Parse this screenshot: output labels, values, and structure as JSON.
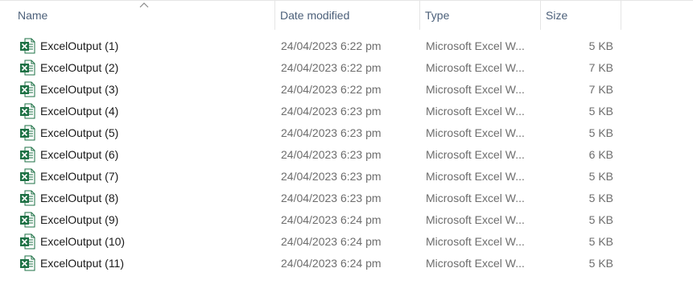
{
  "columns": {
    "name": "Name",
    "date_modified": "Date modified",
    "type": "Type",
    "size": "Size"
  },
  "sort": {
    "column": "name",
    "direction": "ascending",
    "icon": "chevron-up-icon"
  },
  "file_icon": "excel-file-icon",
  "colors": {
    "header_text": "#4c607a",
    "excel_green": "#1e7145",
    "muted_text": "#6d6d6d"
  },
  "files": [
    {
      "name": "ExcelOutput (1)",
      "date": "24/04/2023 6:22 pm",
      "type": "Microsoft Excel W...",
      "size": "5 KB"
    },
    {
      "name": "ExcelOutput (2)",
      "date": "24/04/2023 6:22 pm",
      "type": "Microsoft Excel W...",
      "size": "7 KB"
    },
    {
      "name": "ExcelOutput (3)",
      "date": "24/04/2023 6:22 pm",
      "type": "Microsoft Excel W...",
      "size": "7 KB"
    },
    {
      "name": "ExcelOutput (4)",
      "date": "24/04/2023 6:23 pm",
      "type": "Microsoft Excel W...",
      "size": "5 KB"
    },
    {
      "name": "ExcelOutput (5)",
      "date": "24/04/2023 6:23 pm",
      "type": "Microsoft Excel W...",
      "size": "5 KB"
    },
    {
      "name": "ExcelOutput (6)",
      "date": "24/04/2023 6:23 pm",
      "type": "Microsoft Excel W...",
      "size": "6 KB"
    },
    {
      "name": "ExcelOutput (7)",
      "date": "24/04/2023 6:23 pm",
      "type": "Microsoft Excel W...",
      "size": "5 KB"
    },
    {
      "name": "ExcelOutput (8)",
      "date": "24/04/2023 6:23 pm",
      "type": "Microsoft Excel W...",
      "size": "5 KB"
    },
    {
      "name": "ExcelOutput (9)",
      "date": "24/04/2023 6:24 pm",
      "type": "Microsoft Excel W...",
      "size": "5 KB"
    },
    {
      "name": "ExcelOutput (10)",
      "date": "24/04/2023 6:24 pm",
      "type": "Microsoft Excel W...",
      "size": "5 KB"
    },
    {
      "name": "ExcelOutput (11)",
      "date": "24/04/2023 6:24 pm",
      "type": "Microsoft Excel W...",
      "size": "5 KB"
    }
  ]
}
